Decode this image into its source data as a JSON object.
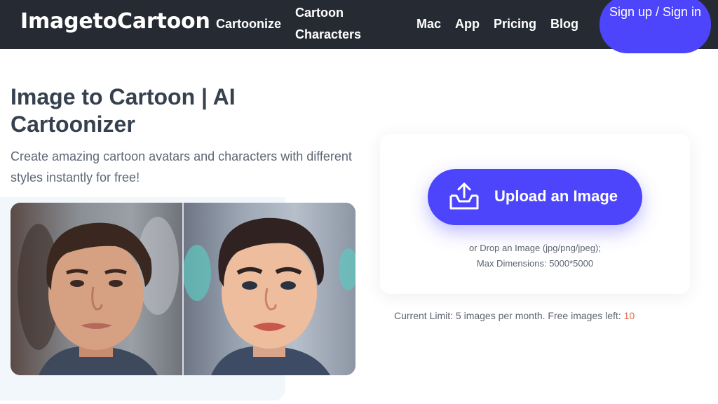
{
  "header": {
    "logo": "ImagetoCartoon",
    "nav": {
      "cartoonize": "Cartoonize",
      "cartoon_characters": "Cartoon Characters",
      "mac": "Mac",
      "app": "App",
      "pricing": "Pricing",
      "blog": "Blog"
    },
    "signup": "Sign up / Sign in"
  },
  "hero": {
    "title": "Image to Cartoon | AI Cartoonizer",
    "subtitle": "Create amazing cartoon avatars and characters with different styles instantly for free!"
  },
  "upload": {
    "button_label": "Upload an Image",
    "icon": "upload-tray-icon",
    "drop_hint": "or Drop an Image (jpg/png/jpeg);",
    "max_dimensions": "Max Dimensions: 5000*5000"
  },
  "limit": {
    "text": "Current Limit: 5 images per month. Free images left: ",
    "remaining": "10"
  },
  "colors": {
    "header_bg": "#262b33",
    "accent": "#4d45fb",
    "remaining_count": "#e0704e"
  }
}
